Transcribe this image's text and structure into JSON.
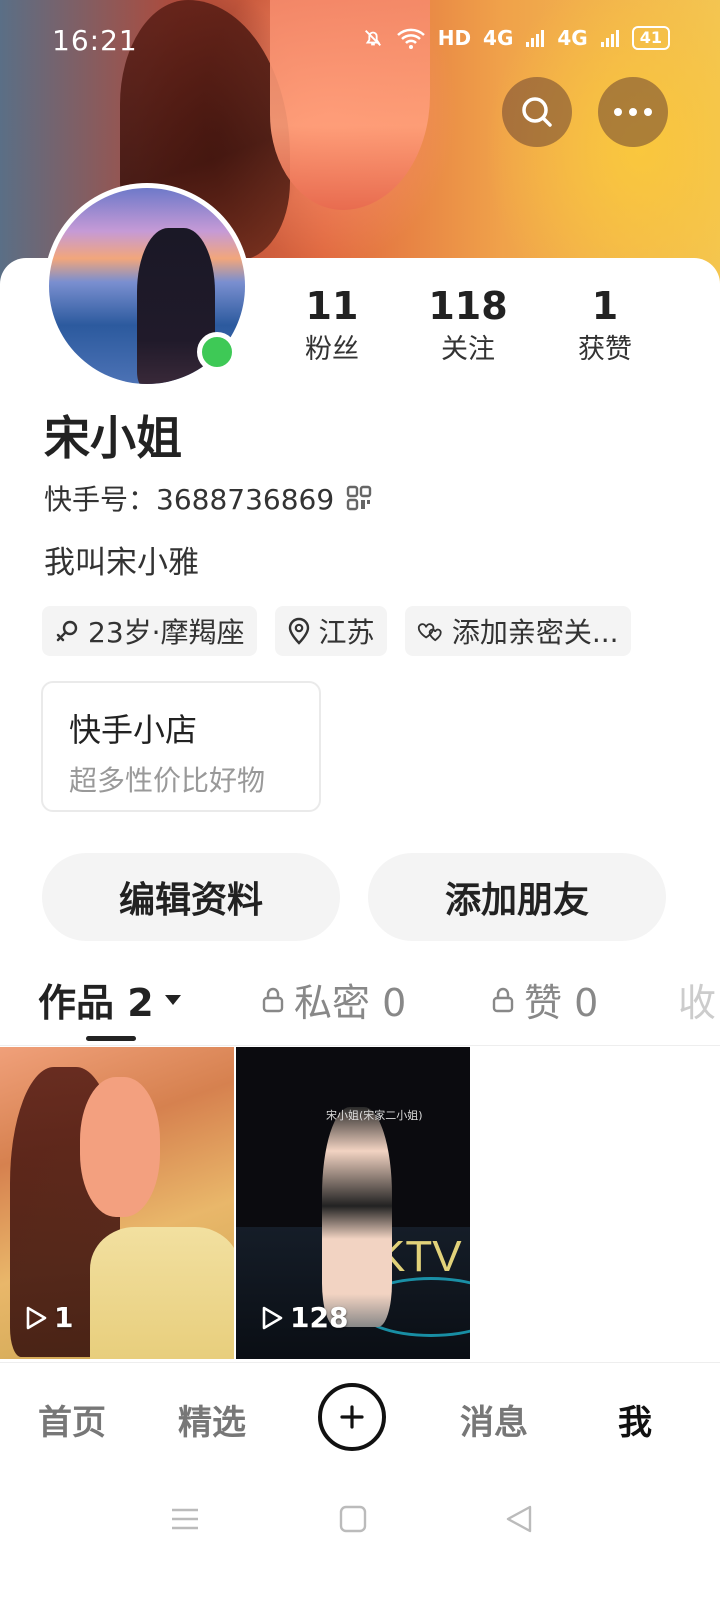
{
  "status_bar": {
    "time": "16:21",
    "network_1": "4G",
    "network_2": "4G",
    "hd": "HD",
    "battery": "41"
  },
  "profile": {
    "stats": [
      {
        "value": "11",
        "label": "粉丝"
      },
      {
        "value": "118",
        "label": "关注"
      },
      {
        "value": "1",
        "label": "获赞"
      }
    ],
    "nickname": "宋小姐",
    "kuaishou_id": "快手号：3688736869",
    "bio": "我叫宋小雅",
    "tags": {
      "age": "23岁·摩羯座",
      "location": "江苏",
      "relation": "添加亲密关..."
    },
    "shop": {
      "title": "快手小店",
      "subtitle": "超多性价比好物"
    },
    "buttons": {
      "edit": "编辑资料",
      "add_friend": "添加朋友"
    }
  },
  "tabs": [
    {
      "label": "作品 2",
      "locked": false,
      "active": true
    },
    {
      "label": "私密 0",
      "locked": true,
      "active": false
    },
    {
      "label": "赞 0",
      "locked": true,
      "active": false
    },
    {
      "label": "收",
      "locked": false,
      "active": false
    }
  ],
  "videos": [
    {
      "plays": "1"
    },
    {
      "plays": "128",
      "overlay_text": "宋小姐(宋家二小姐)",
      "sign_text": "KTV"
    }
  ],
  "bottom_nav": {
    "home": "首页",
    "featured": "精选",
    "messages": "消息",
    "me": "我"
  },
  "colors": {
    "online": "#3ec956",
    "accent": "#222222"
  }
}
